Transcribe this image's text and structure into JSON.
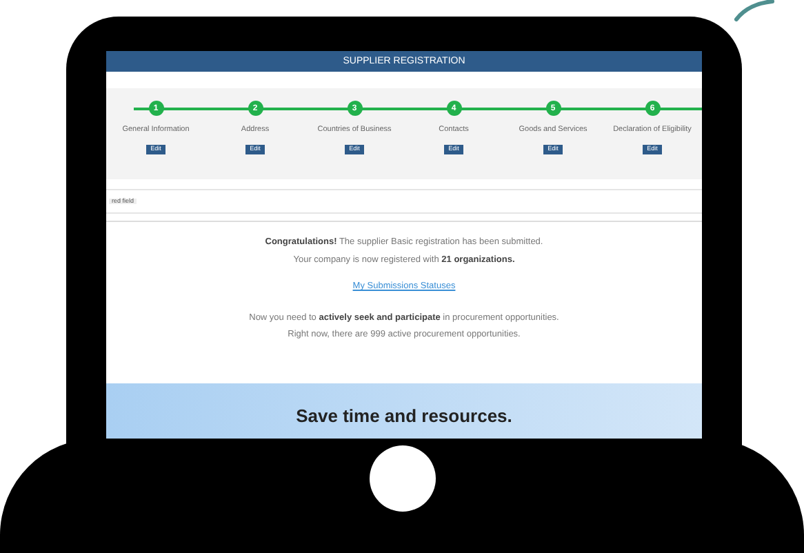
{
  "header": {
    "title": "SUPPLIER REGISTRATION"
  },
  "steps": [
    {
      "number": "1",
      "label": "General Information",
      "edit": "Edit"
    },
    {
      "number": "2",
      "label": "Address",
      "edit": "Edit"
    },
    {
      "number": "3",
      "label": "Countries of Business",
      "edit": "Edit"
    },
    {
      "number": "4",
      "label": "Contacts",
      "edit": "Edit"
    },
    {
      "number": "5",
      "label": "Goods and Services",
      "edit": "Edit"
    },
    {
      "number": "6",
      "label": "Declaration of Eligibility",
      "edit": "Edit"
    }
  ],
  "legend": {
    "chip": "red field"
  },
  "message": {
    "line_1": "**Congratulations!** The supplier Basic registration has been submitted.",
    "line_2": "Your company is now registered with **21 organizations.**",
    "link": "My Submissions Statuses",
    "line_3": "Now you need to **actively seek and participate** in procurement opportunities.",
    "line_4": "Right now, there are 999 active procurement opportunities."
  },
  "banner": {
    "title": "Save time and resources."
  }
}
